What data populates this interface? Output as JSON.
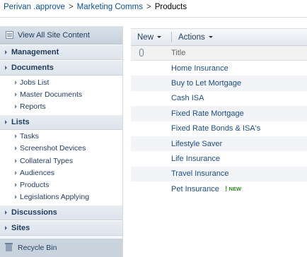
{
  "breadcrumb": {
    "site": "Perivan .approve",
    "sub_site": "Marketing Comms",
    "current": "Products",
    "separator": ">"
  },
  "leftnav": {
    "view_all": "View All Site Content",
    "sections": [
      {
        "label": "Management",
        "items": []
      },
      {
        "label": "Documents",
        "items": [
          "Jobs List",
          "Master Documents",
          "Reports"
        ]
      },
      {
        "label": "Lists",
        "items": [
          "Tasks",
          "Screenshot Devices",
          "Collateral Types",
          "Audiences",
          "Products",
          "Legislations Applying"
        ]
      },
      {
        "label": "Discussions",
        "items": []
      },
      {
        "label": "Sites",
        "items": []
      }
    ],
    "recycle_bin": "Recycle Bin"
  },
  "toolbar": {
    "new_label": "New",
    "actions_label": "Actions"
  },
  "list": {
    "column_title": "Title",
    "rows": [
      {
        "title": "Home Insurance",
        "is_new": false
      },
      {
        "title": "Buy to Let Mortgage",
        "is_new": false
      },
      {
        "title": "Cash ISA",
        "is_new": false
      },
      {
        "title": "Fixed Rate Mortgage",
        "is_new": false
      },
      {
        "title": "Fixed Rate Bonds & ISA's",
        "is_new": false
      },
      {
        "title": "Lifestyle Saver",
        "is_new": false
      },
      {
        "title": "Life Insurance",
        "is_new": false
      },
      {
        "title": "Travel Insurance",
        "is_new": false
      },
      {
        "title": "Pet Insurance",
        "is_new": true
      }
    ],
    "new_badge": "NEW",
    "new_mark": "!"
  },
  "colors": {
    "link": "#0a4f97",
    "nav_header_bg": "#dde4ec",
    "new_badge": "#2b8a1a"
  }
}
